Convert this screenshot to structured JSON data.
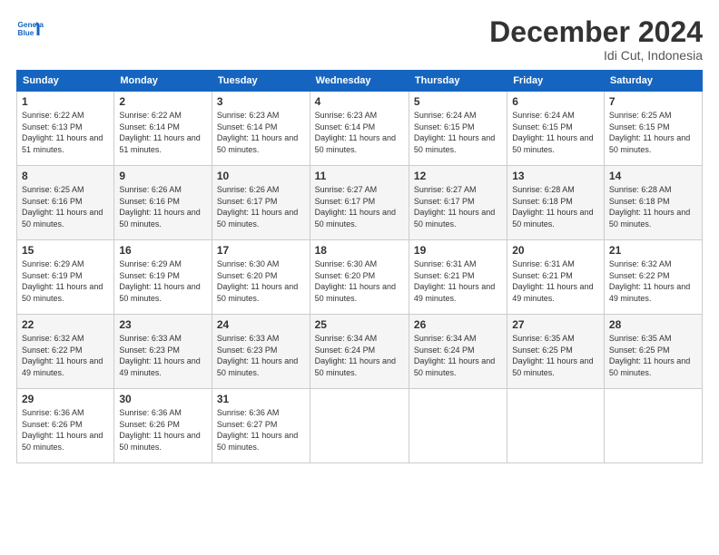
{
  "logo": {
    "line1": "General",
    "line2": "Blue"
  },
  "title": "December 2024",
  "subtitle": "Idi Cut, Indonesia",
  "days_of_week": [
    "Sunday",
    "Monday",
    "Tuesday",
    "Wednesday",
    "Thursday",
    "Friday",
    "Saturday"
  ],
  "weeks": [
    [
      {
        "day": "1",
        "sunrise": "6:22 AM",
        "sunset": "6:13 PM",
        "daylight": "11 hours and 51 minutes."
      },
      {
        "day": "2",
        "sunrise": "6:22 AM",
        "sunset": "6:14 PM",
        "daylight": "11 hours and 51 minutes."
      },
      {
        "day": "3",
        "sunrise": "6:23 AM",
        "sunset": "6:14 PM",
        "daylight": "11 hours and 50 minutes."
      },
      {
        "day": "4",
        "sunrise": "6:23 AM",
        "sunset": "6:14 PM",
        "daylight": "11 hours and 50 minutes."
      },
      {
        "day": "5",
        "sunrise": "6:24 AM",
        "sunset": "6:15 PM",
        "daylight": "11 hours and 50 minutes."
      },
      {
        "day": "6",
        "sunrise": "6:24 AM",
        "sunset": "6:15 PM",
        "daylight": "11 hours and 50 minutes."
      },
      {
        "day": "7",
        "sunrise": "6:25 AM",
        "sunset": "6:15 PM",
        "daylight": "11 hours and 50 minutes."
      }
    ],
    [
      {
        "day": "8",
        "sunrise": "6:25 AM",
        "sunset": "6:16 PM",
        "daylight": "11 hours and 50 minutes."
      },
      {
        "day": "9",
        "sunrise": "6:26 AM",
        "sunset": "6:16 PM",
        "daylight": "11 hours and 50 minutes."
      },
      {
        "day": "10",
        "sunrise": "6:26 AM",
        "sunset": "6:17 PM",
        "daylight": "11 hours and 50 minutes."
      },
      {
        "day": "11",
        "sunrise": "6:27 AM",
        "sunset": "6:17 PM",
        "daylight": "11 hours and 50 minutes."
      },
      {
        "day": "12",
        "sunrise": "6:27 AM",
        "sunset": "6:17 PM",
        "daylight": "11 hours and 50 minutes."
      },
      {
        "day": "13",
        "sunrise": "6:28 AM",
        "sunset": "6:18 PM",
        "daylight": "11 hours and 50 minutes."
      },
      {
        "day": "14",
        "sunrise": "6:28 AM",
        "sunset": "6:18 PM",
        "daylight": "11 hours and 50 minutes."
      }
    ],
    [
      {
        "day": "15",
        "sunrise": "6:29 AM",
        "sunset": "6:19 PM",
        "daylight": "11 hours and 50 minutes."
      },
      {
        "day": "16",
        "sunrise": "6:29 AM",
        "sunset": "6:19 PM",
        "daylight": "11 hours and 50 minutes."
      },
      {
        "day": "17",
        "sunrise": "6:30 AM",
        "sunset": "6:20 PM",
        "daylight": "11 hours and 50 minutes."
      },
      {
        "day": "18",
        "sunrise": "6:30 AM",
        "sunset": "6:20 PM",
        "daylight": "11 hours and 50 minutes."
      },
      {
        "day": "19",
        "sunrise": "6:31 AM",
        "sunset": "6:21 PM",
        "daylight": "11 hours and 49 minutes."
      },
      {
        "day": "20",
        "sunrise": "6:31 AM",
        "sunset": "6:21 PM",
        "daylight": "11 hours and 49 minutes."
      },
      {
        "day": "21",
        "sunrise": "6:32 AM",
        "sunset": "6:22 PM",
        "daylight": "11 hours and 49 minutes."
      }
    ],
    [
      {
        "day": "22",
        "sunrise": "6:32 AM",
        "sunset": "6:22 PM",
        "daylight": "11 hours and 49 minutes."
      },
      {
        "day": "23",
        "sunrise": "6:33 AM",
        "sunset": "6:23 PM",
        "daylight": "11 hours and 49 minutes."
      },
      {
        "day": "24",
        "sunrise": "6:33 AM",
        "sunset": "6:23 PM",
        "daylight": "11 hours and 50 minutes."
      },
      {
        "day": "25",
        "sunrise": "6:34 AM",
        "sunset": "6:24 PM",
        "daylight": "11 hours and 50 minutes."
      },
      {
        "day": "26",
        "sunrise": "6:34 AM",
        "sunset": "6:24 PM",
        "daylight": "11 hours and 50 minutes."
      },
      {
        "day": "27",
        "sunrise": "6:35 AM",
        "sunset": "6:25 PM",
        "daylight": "11 hours and 50 minutes."
      },
      {
        "day": "28",
        "sunrise": "6:35 AM",
        "sunset": "6:25 PM",
        "daylight": "11 hours and 50 minutes."
      }
    ],
    [
      {
        "day": "29",
        "sunrise": "6:36 AM",
        "sunset": "6:26 PM",
        "daylight": "11 hours and 50 minutes."
      },
      {
        "day": "30",
        "sunrise": "6:36 AM",
        "sunset": "6:26 PM",
        "daylight": "11 hours and 50 minutes."
      },
      {
        "day": "31",
        "sunrise": "6:36 AM",
        "sunset": "6:27 PM",
        "daylight": "11 hours and 50 minutes."
      },
      null,
      null,
      null,
      null
    ]
  ],
  "labels": {
    "sunrise": "Sunrise:",
    "sunset": "Sunset:",
    "daylight": "Daylight:"
  }
}
